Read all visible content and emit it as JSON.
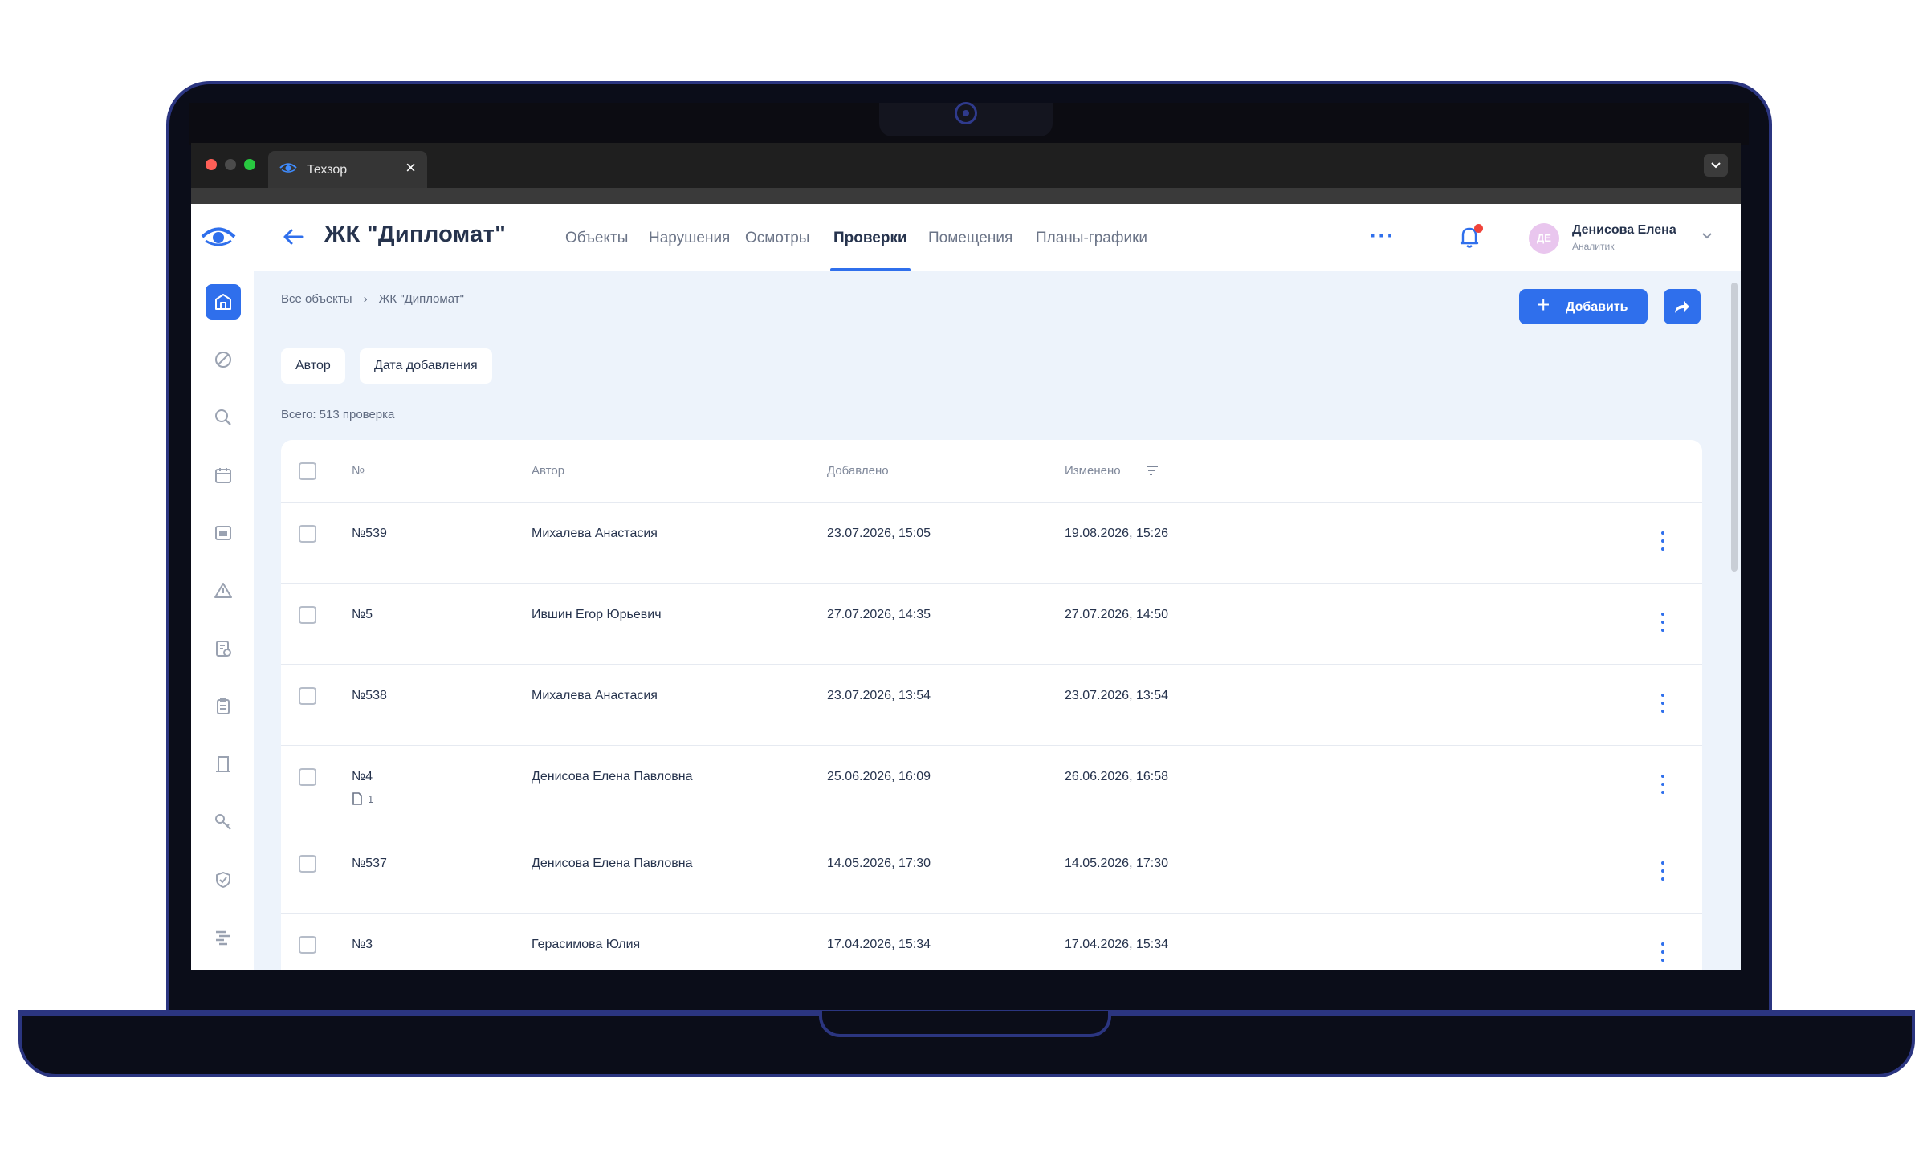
{
  "browser": {
    "tab_title": "Техзор",
    "tab_close": "×"
  },
  "header": {
    "title": "ЖК \"Дипломат\"",
    "nav": [
      "Объекты",
      "Нарушения",
      "Осмотры",
      "Проверки",
      "Помещения",
      "Планы-графики"
    ],
    "active_nav": "Проверки",
    "more": "···",
    "user": {
      "initials": "ДЕ",
      "name": "Денисова Елена",
      "role": "Аналитик"
    }
  },
  "breadcrumb": {
    "root": "Все объекты",
    "sep": "›",
    "current": "ЖК \"Диплoмат\""
  },
  "actions": {
    "add_label": "Добавить",
    "add_plus": "+"
  },
  "filters": [
    "Автор",
    "Дата добавления"
  ],
  "total": "Всего: 513 проверка",
  "table": {
    "columns": {
      "number": "№",
      "author": "Автор",
      "added": "Добавлено",
      "modified": "Изменено"
    },
    "rows": [
      {
        "number": "№539",
        "author": "Михалева Анастасия",
        "added": "23.07.2026, 15:05",
        "modified": "19.08.2026, 15:26"
      },
      {
        "number": "№5",
        "author": "Ившин Егор Юрьевич",
        "added": "27.07.2026, 14:35",
        "modified": "27.07.2026, 14:50"
      },
      {
        "number": "№538",
        "author": "Михалева Анастасия",
        "added": "23.07.2026, 13:54",
        "modified": "23.07.2026, 13:54"
      },
      {
        "number": "№4",
        "author": "Денисова Елена Павловна",
        "added": "25.06.2026, 16:09",
        "modified": "26.06.2026, 16:58",
        "attachments": "1"
      },
      {
        "number": "№537",
        "author": "Денисова Елена Павловна",
        "added": "14.05.2026, 17:30",
        "modified": "14.05.2026, 17:30"
      },
      {
        "number": "№3",
        "author": "Герасимова Юлия",
        "added": "17.04.2026, 15:34",
        "modified": "17.04.2026, 15:34"
      }
    ]
  },
  "sidebar_icons": [
    "building-icon",
    "ban-icon",
    "search-icon",
    "calendar-icon",
    "room-icon",
    "warning-icon",
    "checklist-icon",
    "clipboard-icon",
    "door-icon",
    "key-icon",
    "shield-icon",
    "gantt-icon"
  ],
  "colors": {
    "accent": "#2f6fec",
    "text": "#26334d",
    "background": "#edf3fb",
    "notification": "#f0433a"
  }
}
